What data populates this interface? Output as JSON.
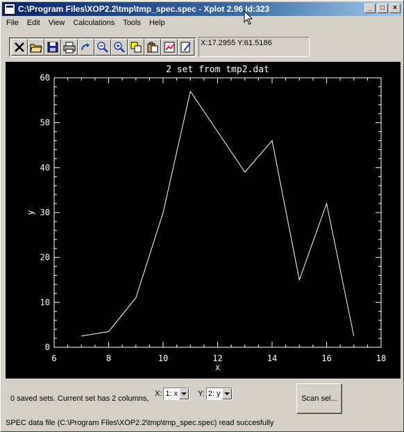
{
  "window": {
    "title": "C:\\Program Files\\XOP2.2\\tmp\\tmp_spec.spec - Xplot 2.96 Id:323",
    "controls": [
      "_",
      "□",
      "×"
    ]
  },
  "menu": [
    "File",
    "Edit",
    "View",
    "Calculations",
    "Tools",
    "Help"
  ],
  "toolbar": {
    "icons": [
      "close-icon",
      "open-folder-icon",
      "save-icon",
      "print-icon",
      "redo-icon",
      "zoom-out-icon",
      "zoom-in-icon",
      "copy-icon",
      "paste-icon",
      "chart-icon",
      "edit-icon"
    ]
  },
  "coords": {
    "text": "X:17.2955 Y:61.5186"
  },
  "chart_data": {
    "type": "line",
    "title": "2 set from tmp2.dat",
    "xlabel": "x",
    "ylabel": "y",
    "xlim": [
      6,
      18
    ],
    "ylim": [
      0,
      60
    ],
    "x_ticks": [
      6,
      8,
      10,
      12,
      14,
      16,
      18
    ],
    "y_ticks": [
      0,
      10,
      20,
      30,
      40,
      50,
      60
    ],
    "x": [
      7,
      8,
      9,
      10,
      11,
      12,
      13,
      14,
      15,
      16,
      17
    ],
    "y": [
      2.5,
      3.5,
      11,
      30,
      57,
      48,
      39,
      46,
      15,
      32,
      2.5
    ],
    "background": "#000000",
    "line_color": "#ffffff"
  },
  "status": {
    "sets_text": "0  saved sets. Current set has  2  columns,",
    "x_label": "X:",
    "x_value": "1: x",
    "y_label": "Y:",
    "y_value": "2: y",
    "scan_button": "Scan sel...",
    "message": "SPEC data file (C:\\Program Files\\XOP2.2\\tmp\\tmp_spec.spec) read succesfully"
  }
}
